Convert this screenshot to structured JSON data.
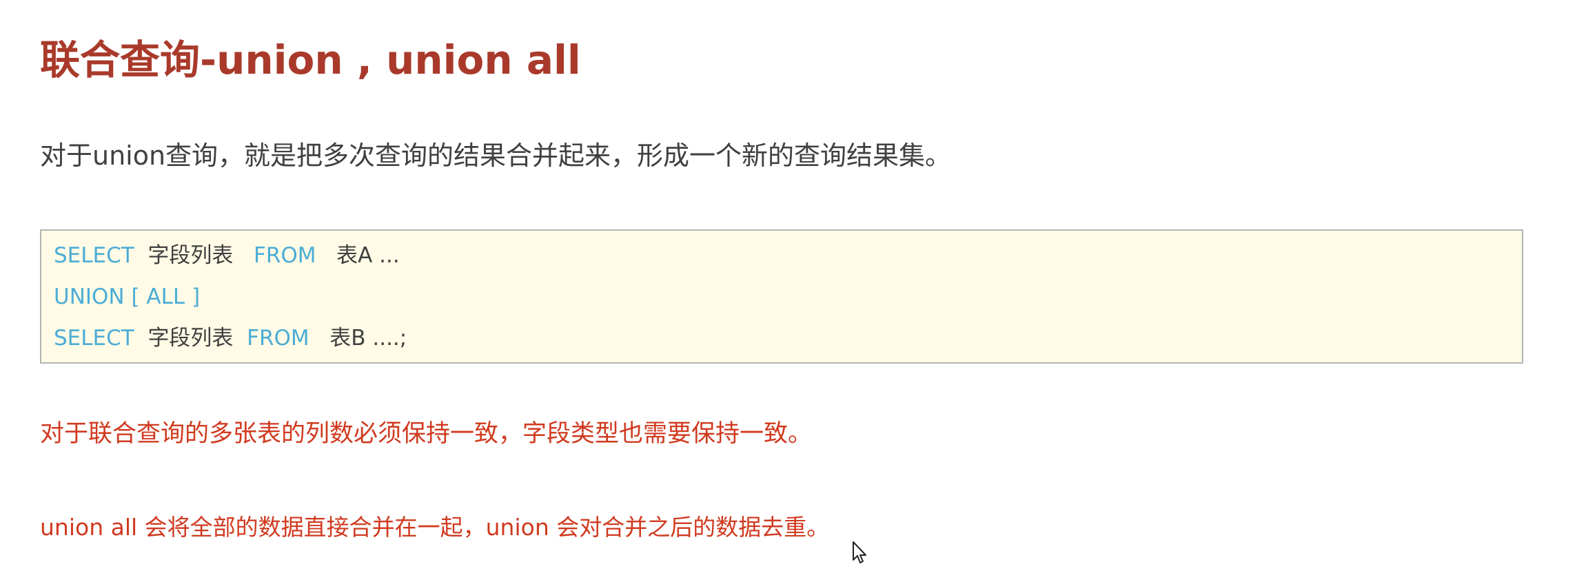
{
  "title": "联合查询-union , union all",
  "intro": "对于union查询，就是把多次查询的结果合并起来，形成一个新的查询结果集。",
  "code": {
    "line1": {
      "kw1": "SELECT",
      "t1": "字段列表",
      "kw2": "FROM",
      "t2": "表A ..."
    },
    "line2": {
      "kw1": "UNION [ ALL ]"
    },
    "line3": {
      "kw1": "SELECT",
      "t1": "字段列表",
      "kw2": "FROM",
      "t2": "表B ....;"
    }
  },
  "notes": [
    "对于联合查询的多张表的列数必须保持一致，字段类型也需要保持一致。",
    "union all 会将全部的数据直接合并在一起，union 会对合并之后的数据去重。"
  ],
  "colors": {
    "title": "#a93a2b",
    "note": "#d03a1f",
    "keyword": "#4bacd6",
    "code_bg": "#fffbe6",
    "body_text": "#404040"
  }
}
